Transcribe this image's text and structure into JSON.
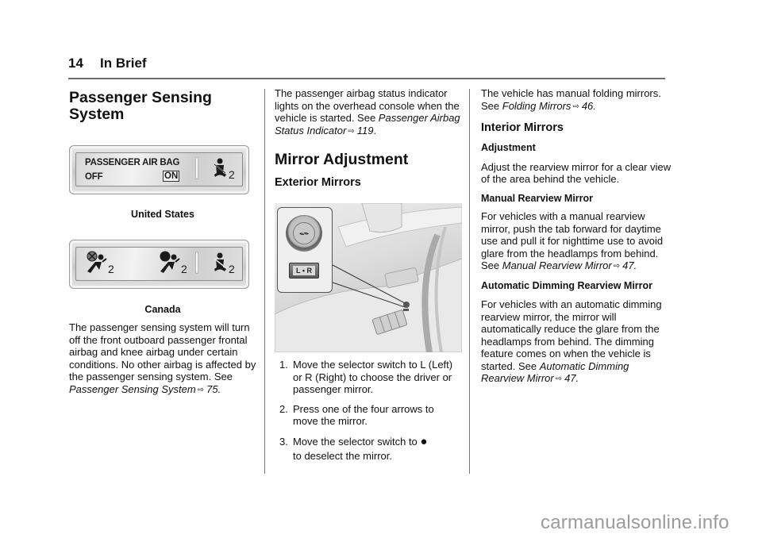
{
  "header": {
    "page_number": "14",
    "section": "In Brief"
  },
  "column1": {
    "title": "Passenger Sensing System",
    "panel_us": {
      "label_line1": "PASSENGER AIR BAG",
      "label_off": "OFF",
      "label_on": "ON",
      "icon": "seatbelt-reminder-icon",
      "subscript": "2"
    },
    "caption_us": "United States",
    "panel_canada": {
      "icons": [
        "airbag-off-icon",
        "airbag-on-icon",
        "seatbelt-reminder-icon"
      ],
      "subscripts": [
        "2",
        "2",
        "2"
      ]
    },
    "caption_canada": "Canada",
    "paragraph": {
      "text": "The passenger sensing system will turn off the front outboard passenger frontal airbag and knee airbag under certain conditions. No other airbag is affected by the passenger sensing system. See ",
      "link_text": "Passenger Sensing System",
      "ref_icon": "arrow-right-icon",
      "page_ref": "75"
    }
  },
  "column2": {
    "intro": {
      "text": "The passenger airbag status indicator lights on the overhead console when the vehicle is started. See ",
      "link_text": "Passenger Airbag Status Indicator",
      "page_ref": "119"
    },
    "section_title": "Mirror Adjustment",
    "subsection_title": "Exterior Mirrors",
    "figure": {
      "inset_knob_label": "mirror-control-knob",
      "selector_label": "L • R"
    },
    "steps": [
      {
        "num": "1.",
        "text": "Move the selector switch to L (Left) or R (Right) to choose the driver or passenger mirror."
      },
      {
        "num": "2.",
        "text": "Press one of the four arrows to move the mirror."
      },
      {
        "num": "3.",
        "text": "Move the selector switch to",
        "symbol": "●",
        "text_after": "to deselect the mirror."
      }
    ]
  },
  "column3": {
    "intro": {
      "text": "The vehicle has manual folding mirrors. See ",
      "link_text": "Folding Mirrors",
      "page_ref": "46"
    },
    "interior_title": "Interior Mirrors",
    "adjustment_title": "Adjustment",
    "adjustment_text": "Adjust the rearview mirror for a clear view of the area behind the vehicle.",
    "manual_title": "Manual Rearview Mirror",
    "manual": {
      "text": "For vehicles with a manual rearview mirror, push the tab forward for daytime use and pull it for nighttime use to avoid glare from the headlamps from behind. See ",
      "link_text": "Manual Rearview Mirror",
      "page_ref": "47"
    },
    "auto_title": "Automatic Dimming Rearview Mirror",
    "auto": {
      "text": "For vehicles with an automatic dimming rearview mirror, the mirror will automatically reduce the glare from the headlamps from behind. The dimming feature comes on when the vehicle is started. See ",
      "link_text": "Automatic Dimming Rearview Mirror",
      "page_ref": "47"
    }
  },
  "ref_arrow_glyph": "⇨",
  "watermark": "carmanualsonline.info"
}
